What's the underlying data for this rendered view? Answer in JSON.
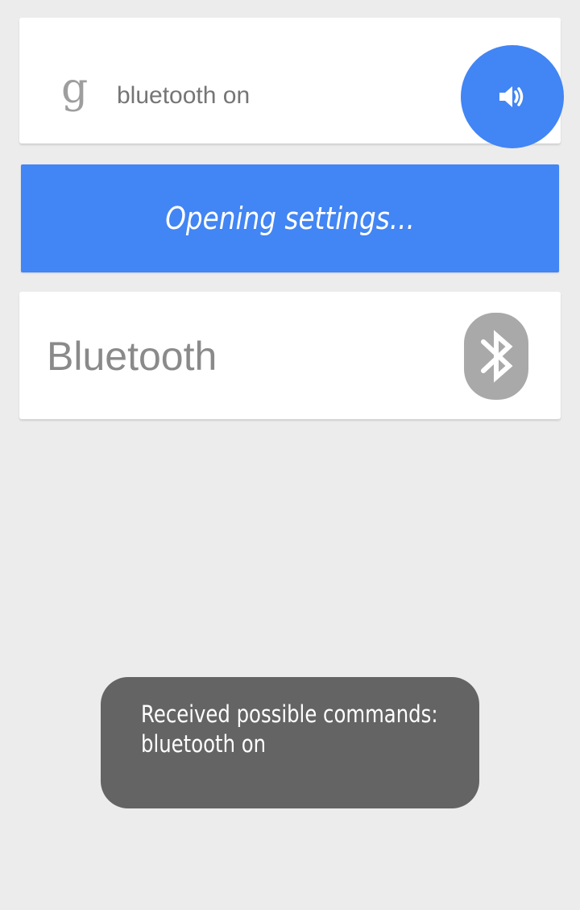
{
  "search": {
    "logo_glyph": "g",
    "query": "bluetooth on",
    "speak_icon": "volume-speaker-icon"
  },
  "status": {
    "text": "Opening settings..."
  },
  "result": {
    "title": "Bluetooth",
    "icon": "bluetooth-icon"
  },
  "toast": {
    "line1": "Received possible commands:",
    "line2": "bluetooth on"
  },
  "colors": {
    "accent": "#4285f4",
    "background": "#ececec",
    "toast": "#646464",
    "icon_gray": "#a9a9a9"
  }
}
